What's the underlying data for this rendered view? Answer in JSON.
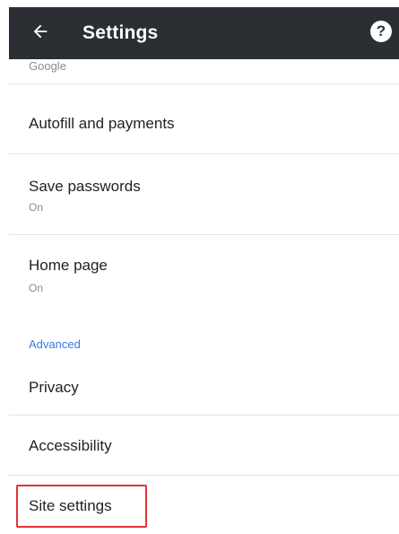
{
  "toolbar": {
    "title": "Settings",
    "back_icon": "arrow-back-icon",
    "help_icon": "help-icon",
    "help_glyph": "?"
  },
  "list": {
    "partial_sub": "Google",
    "items": [
      {
        "label": "Autofill and payments",
        "sub": ""
      },
      {
        "label": "Save passwords",
        "sub": "On"
      },
      {
        "label": "Home page",
        "sub": "On"
      }
    ],
    "section_header": "Advanced",
    "advanced_items": [
      {
        "label": "Privacy"
      },
      {
        "label": "Accessibility"
      },
      {
        "label": "Site settings"
      }
    ]
  },
  "colors": {
    "toolbar_bg": "#2b2f33",
    "accent": "#3b78e7",
    "highlight": "#e0343a"
  }
}
